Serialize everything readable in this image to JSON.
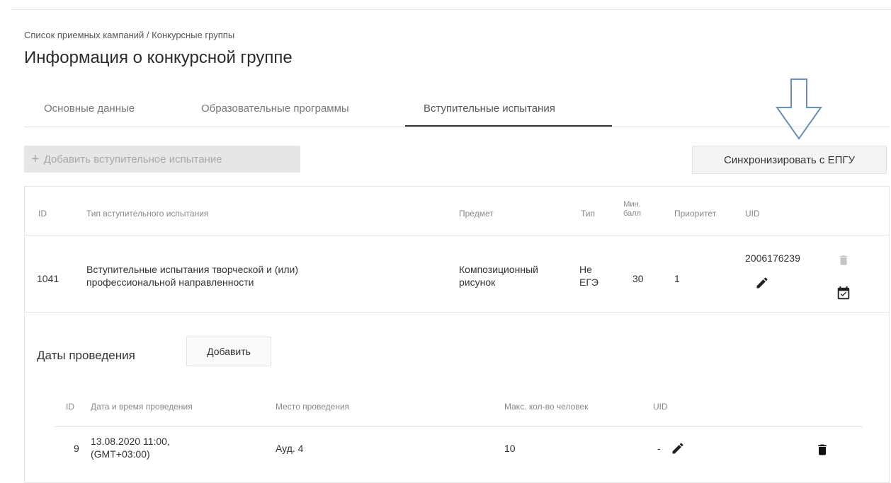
{
  "breadcrumb": "Список приемных кампаний / Конкурсные группы",
  "title": "Информация о конкурсной группе",
  "tabs": [
    {
      "label": "Основные данные"
    },
    {
      "label": "Образовательные программы"
    },
    {
      "label": "Вступительные испытания"
    }
  ],
  "active_tab_index": 2,
  "toolbar": {
    "add_label": "Добавить вступительное испытание",
    "sync_label": "Синхронизировать с ЕПГУ"
  },
  "tests_table": {
    "headers": {
      "id": "ID",
      "type": "Тип вступительного испытания",
      "subject": "Предмет",
      "kind": "Тип",
      "min_score_line1": "Мин.",
      "min_score_line2": "балл",
      "priority": "Приоритет",
      "uid": "UID"
    },
    "rows": [
      {
        "id": "1041",
        "type_line1": "Вступительные испытания творческой и (или)",
        "type_line2": "профессиональной направленности",
        "subject_line1": "Композиционный",
        "subject_line2": "рисунок",
        "kind_line1": "Не",
        "kind_line2": "ЕГЭ",
        "min_score": "30",
        "priority": "1",
        "uid": "2006176239"
      }
    ]
  },
  "dates_section": {
    "label": "Даты проведения",
    "add_label": "Добавить",
    "headers": {
      "id": "ID",
      "datetime": "Дата и время проведения",
      "place": "Место проведения",
      "max_people": "Макс. кол-во человек",
      "uid": "UID"
    },
    "rows": [
      {
        "id": "9",
        "datetime_line1": "13.08.2020 11:00,",
        "datetime_line2": "(GMT+03:00)",
        "place": "Ауд. 4",
        "max_people": "10",
        "uid": "-"
      }
    ]
  },
  "colors": {
    "annotation_arrow": "#6b8fb5",
    "disabled_button_bg": "#e6e6e6",
    "text": "#333333"
  },
  "icons": [
    "plus-icon",
    "arrow-down-annotation",
    "pencil-icon",
    "trash-icon",
    "calendar-check-icon"
  ]
}
